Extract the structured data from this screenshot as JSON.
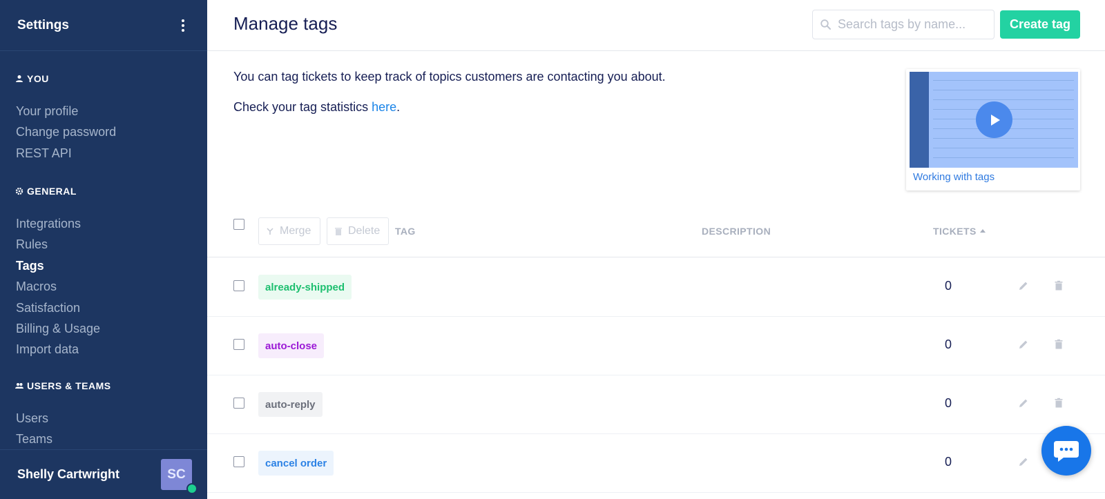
{
  "sidebar": {
    "title": "Settings",
    "sections": [
      {
        "title": "YOU",
        "icon": "person-icon",
        "items": [
          "Your profile",
          "Change password",
          "REST API"
        ]
      },
      {
        "title": "GENERAL",
        "icon": "gear-icon",
        "items": [
          "Integrations",
          "Rules",
          "Tags",
          "Macros",
          "Satisfaction",
          "Billing & Usage",
          "Import data"
        ]
      },
      {
        "title": "USERS & TEAMS",
        "icon": "people-icon",
        "items": [
          "Users",
          "Teams"
        ]
      }
    ],
    "active_item": "Tags",
    "user": {
      "name": "Shelly Cartwright",
      "initials": "SC",
      "status": "online"
    }
  },
  "header": {
    "title": "Manage tags",
    "search_placeholder": "Search tags by name...",
    "create_label": "Create tag"
  },
  "intro": {
    "line1": "You can tag tickets to keep track of topics customers are contacting you about.",
    "line2_prefix": "Check your tag statistics ",
    "line2_link": "here",
    "line2_suffix": "."
  },
  "video": {
    "label": "Working with tags"
  },
  "table": {
    "merge_label": "Merge",
    "delete_label": "Delete",
    "columns": {
      "tag": "TAG",
      "description": "DESCRIPTION",
      "tickets": "TICKETS"
    },
    "sort": {
      "column": "tickets",
      "direction": "ascending"
    },
    "rows": [
      {
        "tag": "already-shipped",
        "description": "",
        "tickets": "0",
        "color": "#1dbf6f",
        "bg": "#eafaf1"
      },
      {
        "tag": "auto-close",
        "description": "",
        "tickets": "0",
        "color": "#9b19d6",
        "bg": "#f7edfc"
      },
      {
        "tag": "auto-reply",
        "description": "",
        "tickets": "0",
        "color": "#6b6f7b",
        "bg": "#f1f2f4"
      },
      {
        "tag": "cancel order",
        "description": "",
        "tickets": "0",
        "color": "#2c82e5",
        "bg": "#ecf4fd"
      }
    ]
  },
  "colors": {
    "sidebar_bg": "#1d3661",
    "accent": "#23d2a2",
    "link": "#1a84e8",
    "chat": "#1876e9"
  }
}
